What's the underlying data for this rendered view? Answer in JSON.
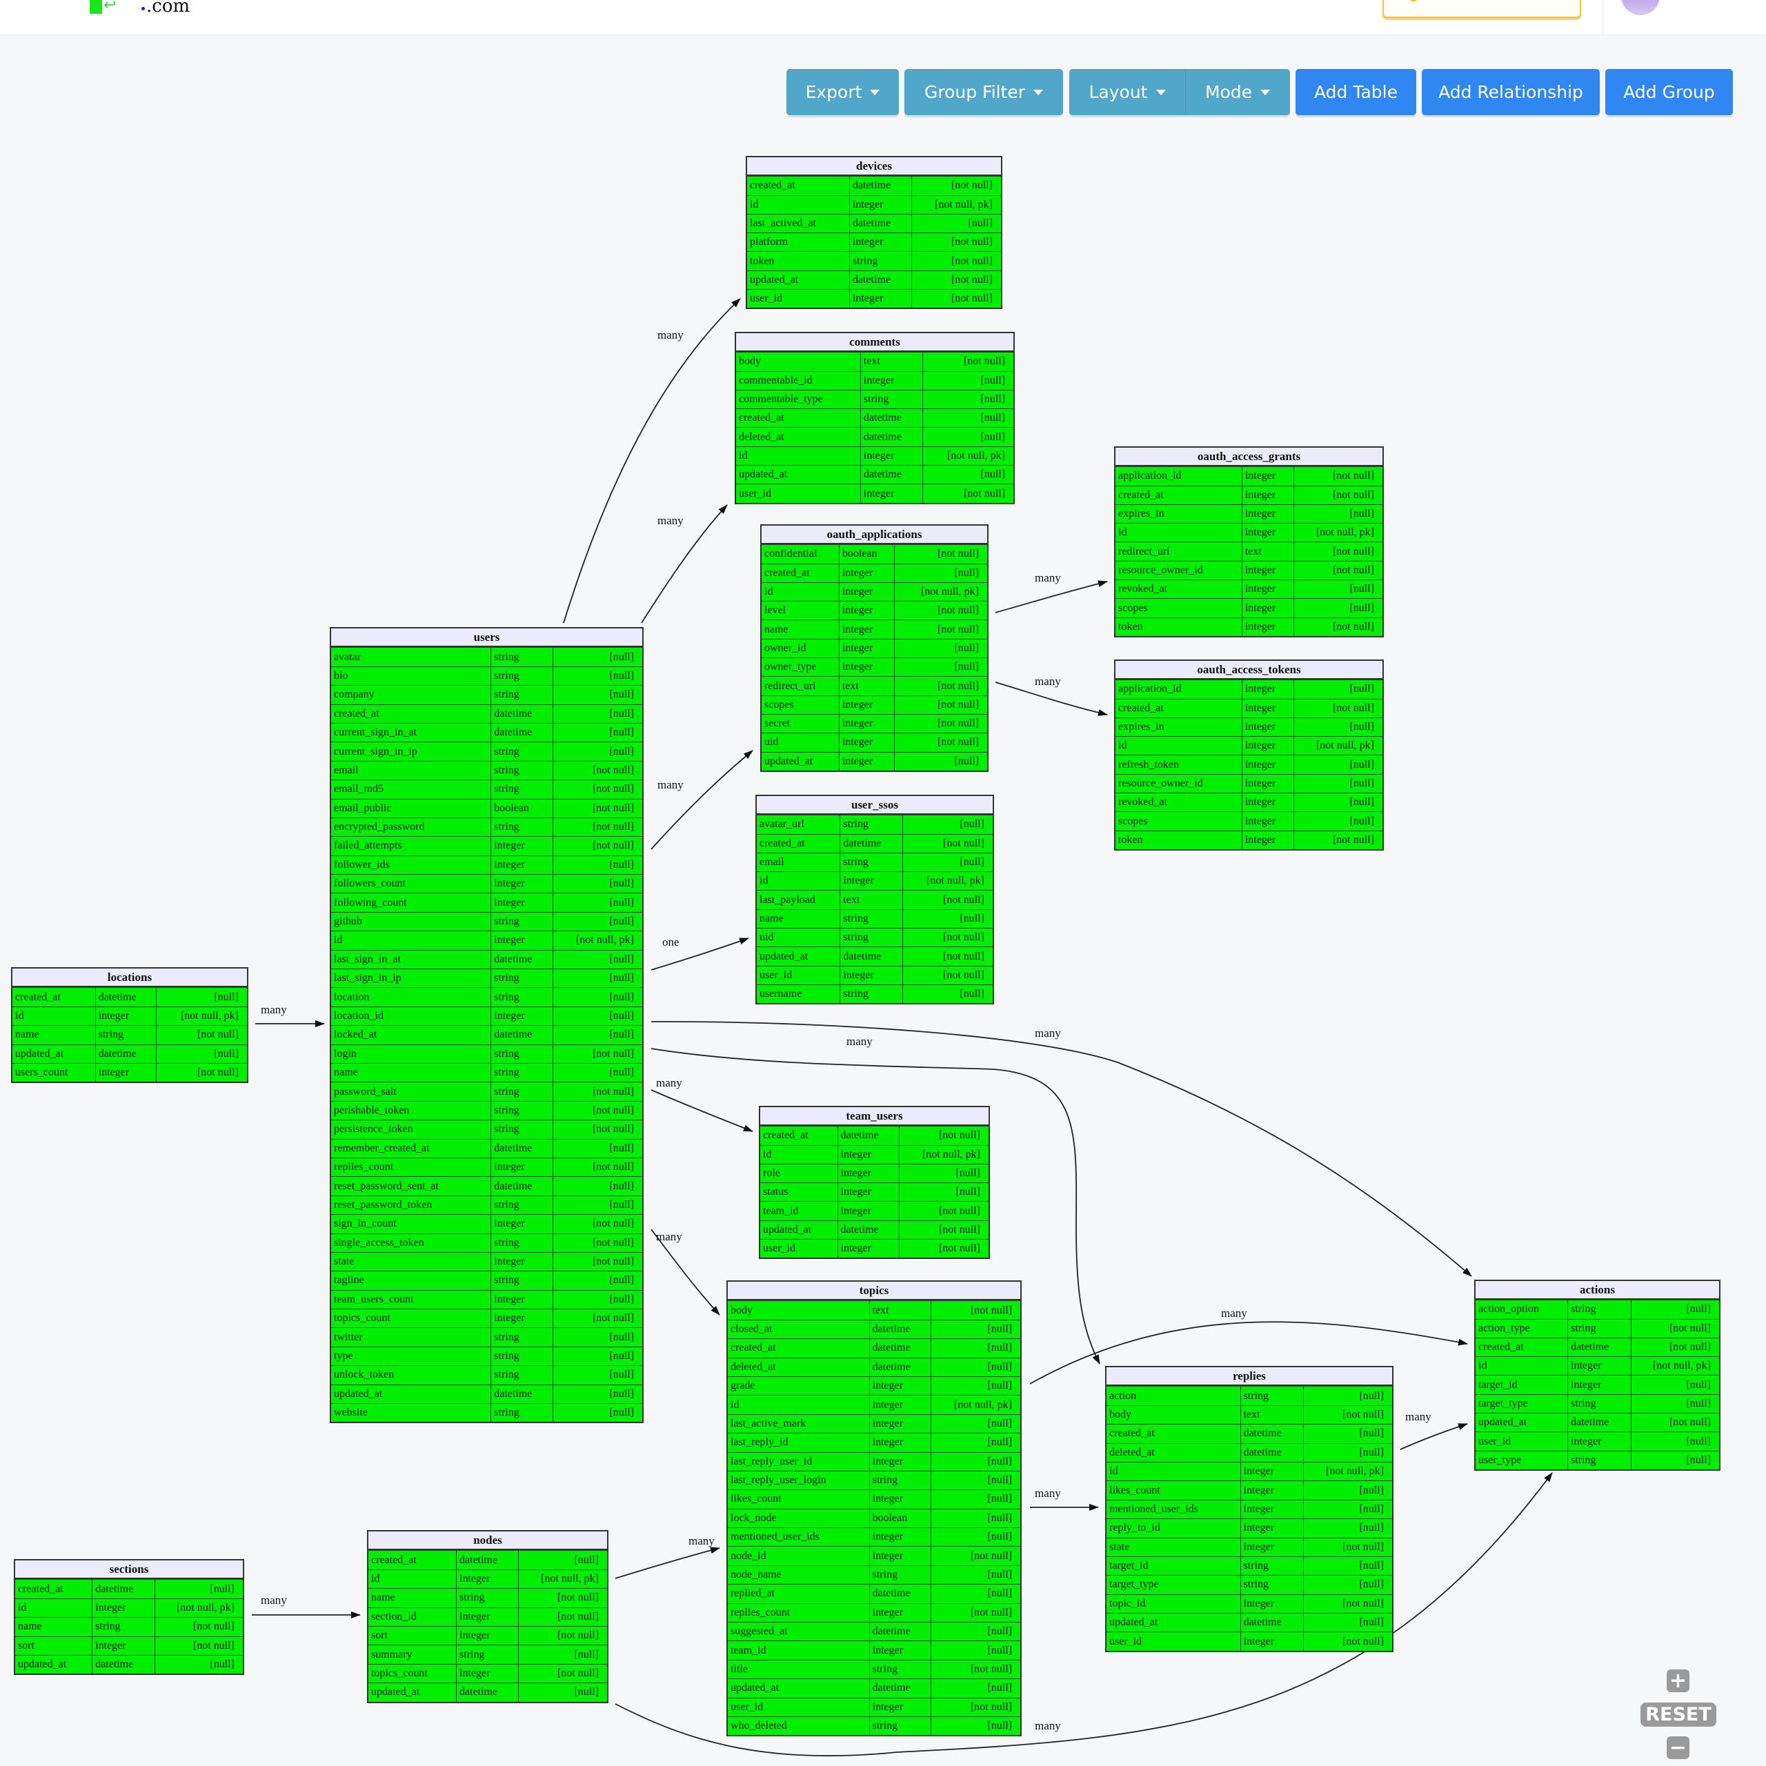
{
  "header": {
    "logo_suffix": ".com",
    "logo_icon": "return-arrow-icon"
  },
  "toolbar": {
    "export": "Export",
    "group_filter": "Group Filter",
    "layout": "Layout",
    "mode": "Mode",
    "add_table": "Add Table",
    "add_relationship": "Add Relationship",
    "add_group": "Add Group"
  },
  "colors": {
    "row_bg": "#00ee00",
    "header_bg": "#ebebfb",
    "info_button": "#51a7c9",
    "primary_button": "#2f87ef"
  },
  "zoom_controls": {
    "zoom_in": "+",
    "reset": "RESET",
    "zoom_out": "−"
  },
  "tables": {
    "devices": {
      "name": "devices",
      "columns": [
        [
          "created_at",
          "datetime",
          "[not null]"
        ],
        [
          "id",
          "integer",
          "[not null, pk]"
        ],
        [
          "last_actived_at",
          "datetime",
          "[null]"
        ],
        [
          "platform",
          "integer",
          "[not null]"
        ],
        [
          "token",
          "string",
          "[not null]"
        ],
        [
          "updated_at",
          "datetime",
          "[not null]"
        ],
        [
          "user_id",
          "integer",
          "[not null]"
        ]
      ]
    },
    "comments": {
      "name": "comments",
      "columns": [
        [
          "body",
          "text",
          "[not null]"
        ],
        [
          "commentable_id",
          "integer",
          "[null]"
        ],
        [
          "commentable_type",
          "string",
          "[null]"
        ],
        [
          "created_at",
          "datetime",
          "[null]"
        ],
        [
          "deleted_at",
          "datetime",
          "[null]"
        ],
        [
          "id",
          "integer",
          "[not null, pk]"
        ],
        [
          "updated_at",
          "datetime",
          "[null]"
        ],
        [
          "user_id",
          "integer",
          "[not null]"
        ]
      ]
    },
    "oauth_applications": {
      "name": "oauth_applications",
      "columns": [
        [
          "confidential",
          "boolean",
          "[not null]"
        ],
        [
          "created_at",
          "integer",
          "[null]"
        ],
        [
          "id",
          "integer",
          "[not null, pk]"
        ],
        [
          "level",
          "integer",
          "[not null]"
        ],
        [
          "name",
          "integer",
          "[not null]"
        ],
        [
          "owner_id",
          "integer",
          "[null]"
        ],
        [
          "owner_type",
          "integer",
          "[null]"
        ],
        [
          "redirect_uri",
          "text",
          "[not null]"
        ],
        [
          "scopes",
          "integer",
          "[not null]"
        ],
        [
          "secret",
          "integer",
          "[not null]"
        ],
        [
          "uid",
          "integer",
          "[not null]"
        ],
        [
          "updated_at",
          "integer",
          "[null]"
        ]
      ]
    },
    "oauth_access_grants": {
      "name": "oauth_access_grants",
      "columns": [
        [
          "application_id",
          "integer",
          "[not null]"
        ],
        [
          "created_at",
          "integer",
          "[not null]"
        ],
        [
          "expires_in",
          "integer",
          "[null]"
        ],
        [
          "id",
          "integer",
          "[not null, pk]"
        ],
        [
          "redirect_uri",
          "text",
          "[not null]"
        ],
        [
          "resource_owner_id",
          "integer",
          "[not null]"
        ],
        [
          "revoked_at",
          "integer",
          "[null]"
        ],
        [
          "scopes",
          "integer",
          "[null]"
        ],
        [
          "token",
          "integer",
          "[not null]"
        ]
      ]
    },
    "oauth_access_tokens": {
      "name": "oauth_access_tokens",
      "columns": [
        [
          "application_id",
          "integer",
          "[null]"
        ],
        [
          "created_at",
          "integer",
          "[not null]"
        ],
        [
          "expires_in",
          "integer",
          "[null]"
        ],
        [
          "id",
          "integer",
          "[not null, pk]"
        ],
        [
          "refresh_token",
          "integer",
          "[null]"
        ],
        [
          "resource_owner_id",
          "integer",
          "[null]"
        ],
        [
          "revoked_at",
          "integer",
          "[null]"
        ],
        [
          "scopes",
          "integer",
          "[null]"
        ],
        [
          "token",
          "integer",
          "[not null]"
        ]
      ]
    },
    "user_ssos": {
      "name": "user_ssos",
      "columns": [
        [
          "avatar_url",
          "string",
          "[null]"
        ],
        [
          "created_at",
          "datetime",
          "[not null]"
        ],
        [
          "email",
          "string",
          "[null]"
        ],
        [
          "id",
          "integer",
          "[not null, pk]"
        ],
        [
          "last_payload",
          "text",
          "[not null]"
        ],
        [
          "name",
          "string",
          "[null]"
        ],
        [
          "uid",
          "string",
          "[not null]"
        ],
        [
          "updated_at",
          "datetime",
          "[not null]"
        ],
        [
          "user_id",
          "integer",
          "[not null]"
        ],
        [
          "username",
          "string",
          "[null]"
        ]
      ]
    },
    "users": {
      "name": "users",
      "columns": [
        [
          "avatar",
          "string",
          "[null]"
        ],
        [
          "bio",
          "string",
          "[null]"
        ],
        [
          "company",
          "string",
          "[null]"
        ],
        [
          "created_at",
          "datetime",
          "[null]"
        ],
        [
          "current_sign_in_at",
          "datetime",
          "[null]"
        ],
        [
          "current_sign_in_ip",
          "string",
          "[null]"
        ],
        [
          "email",
          "string",
          "[not null]"
        ],
        [
          "email_md5",
          "string",
          "[not null]"
        ],
        [
          "email_public",
          "boolean",
          "[not null]"
        ],
        [
          "encrypted_password",
          "string",
          "[not null]"
        ],
        [
          "failed_attempts",
          "integer",
          "[not null]"
        ],
        [
          "follower_ids",
          "integer",
          "[null]"
        ],
        [
          "followers_count",
          "integer",
          "[null]"
        ],
        [
          "following_count",
          "integer",
          "[null]"
        ],
        [
          "github",
          "string",
          "[null]"
        ],
        [
          "id",
          "integer",
          "[not null, pk]"
        ],
        [
          "last_sign_in_at",
          "datetime",
          "[null]"
        ],
        [
          "last_sign_in_ip",
          "string",
          "[null]"
        ],
        [
          "location",
          "string",
          "[null]"
        ],
        [
          "location_id",
          "integer",
          "[null]"
        ],
        [
          "locked_at",
          "datetime",
          "[null]"
        ],
        [
          "login",
          "string",
          "[not null]"
        ],
        [
          "name",
          "string",
          "[null]"
        ],
        [
          "password_salt",
          "string",
          "[not null]"
        ],
        [
          "perishable_token",
          "string",
          "[not null]"
        ],
        [
          "persistence_token",
          "string",
          "[not null]"
        ],
        [
          "remember_created_at",
          "datetime",
          "[null]"
        ],
        [
          "replies_count",
          "integer",
          "[not null]"
        ],
        [
          "reset_password_sent_at",
          "datetime",
          "[null]"
        ],
        [
          "reset_password_token",
          "string",
          "[null]"
        ],
        [
          "sign_in_count",
          "integer",
          "[not null]"
        ],
        [
          "single_access_token",
          "string",
          "[not null]"
        ],
        [
          "state",
          "integer",
          "[not null]"
        ],
        [
          "tagline",
          "string",
          "[null]"
        ],
        [
          "team_users_count",
          "integer",
          "[null]"
        ],
        [
          "topics_count",
          "integer",
          "[not null]"
        ],
        [
          "twitter",
          "string",
          "[null]"
        ],
        [
          "type",
          "string",
          "[null]"
        ],
        [
          "unlock_token",
          "string",
          "[null]"
        ],
        [
          "updated_at",
          "datetime",
          "[null]"
        ],
        [
          "website",
          "string",
          "[null]"
        ]
      ]
    },
    "locations": {
      "name": "locations",
      "columns": [
        [
          "created_at",
          "datetime",
          "[null]"
        ],
        [
          "id",
          "integer",
          "[not null, pk]"
        ],
        [
          "name",
          "string",
          "[not null]"
        ],
        [
          "updated_at",
          "datetime",
          "[null]"
        ],
        [
          "users_count",
          "integer",
          "[not null]"
        ]
      ]
    },
    "team_users": {
      "name": "team_users",
      "columns": [
        [
          "created_at",
          "datetime",
          "[not null]"
        ],
        [
          "id",
          "integer",
          "[not null, pk]"
        ],
        [
          "role",
          "integer",
          "[null]"
        ],
        [
          "status",
          "integer",
          "[null]"
        ],
        [
          "team_id",
          "integer",
          "[not null]"
        ],
        [
          "updated_at",
          "datetime",
          "[not null]"
        ],
        [
          "user_id",
          "integer",
          "[not null]"
        ]
      ]
    },
    "topics": {
      "name": "topics",
      "columns": [
        [
          "body",
          "text",
          "[not null]"
        ],
        [
          "closed_at",
          "datetime",
          "[null]"
        ],
        [
          "created_at",
          "datetime",
          "[null]"
        ],
        [
          "deleted_at",
          "datetime",
          "[null]"
        ],
        [
          "grade",
          "integer",
          "[null]"
        ],
        [
          "id",
          "integer",
          "[not null, pk]"
        ],
        [
          "last_active_mark",
          "integer",
          "[null]"
        ],
        [
          "last_reply_id",
          "integer",
          "[null]"
        ],
        [
          "last_reply_user_id",
          "integer",
          "[null]"
        ],
        [
          "last_reply_user_login",
          "string",
          "[null]"
        ],
        [
          "likes_count",
          "integer",
          "[null]"
        ],
        [
          "lock_node",
          "boolean",
          "[null]"
        ],
        [
          "mentioned_user_ids",
          "integer",
          "[null]"
        ],
        [
          "node_id",
          "integer",
          "[not null]"
        ],
        [
          "node_name",
          "string",
          "[null]"
        ],
        [
          "replied_at",
          "datetime",
          "[null]"
        ],
        [
          "replies_count",
          "integer",
          "[not null]"
        ],
        [
          "suggested_at",
          "datetime",
          "[null]"
        ],
        [
          "team_id",
          "integer",
          "[null]"
        ],
        [
          "title",
          "string",
          "[not null]"
        ],
        [
          "updated_at",
          "datetime",
          "[null]"
        ],
        [
          "user_id",
          "integer",
          "[not null]"
        ],
        [
          "who_deleted",
          "string",
          "[null]"
        ]
      ]
    },
    "replies": {
      "name": "replies",
      "columns": [
        [
          "action",
          "string",
          "[null]"
        ],
        [
          "body",
          "text",
          "[not null]"
        ],
        [
          "created_at",
          "datetime",
          "[null]"
        ],
        [
          "deleted_at",
          "datetime",
          "[null]"
        ],
        [
          "id",
          "integer",
          "[not null, pk]"
        ],
        [
          "likes_count",
          "integer",
          "[null]"
        ],
        [
          "mentioned_user_ids",
          "integer",
          "[null]"
        ],
        [
          "reply_to_id",
          "integer",
          "[null]"
        ],
        [
          "state",
          "integer",
          "[not null]"
        ],
        [
          "target_id",
          "string",
          "[null]"
        ],
        [
          "target_type",
          "string",
          "[null]"
        ],
        [
          "topic_id",
          "integer",
          "[not null]"
        ],
        [
          "updated_at",
          "datetime",
          "[null]"
        ],
        [
          "user_id",
          "integer",
          "[not null]"
        ]
      ]
    },
    "actions": {
      "name": "actions",
      "columns": [
        [
          "action_option",
          "string",
          "[null]"
        ],
        [
          "action_type",
          "string",
          "[not null]"
        ],
        [
          "created_at",
          "datetime",
          "[not null]"
        ],
        [
          "id",
          "integer",
          "[not null, pk]"
        ],
        [
          "target_id",
          "integer",
          "[null]"
        ],
        [
          "target_type",
          "string",
          "[null]"
        ],
        [
          "updated_at",
          "datetime",
          "[not null]"
        ],
        [
          "user_id",
          "integer",
          "[null]"
        ],
        [
          "user_type",
          "string",
          "[null]"
        ]
      ]
    },
    "sections": {
      "name": "sections",
      "columns": [
        [
          "created_at",
          "datetime",
          "[null]"
        ],
        [
          "id",
          "integer",
          "[not null, pk]"
        ],
        [
          "name",
          "string",
          "[not null]"
        ],
        [
          "sort",
          "integer",
          "[not null]"
        ],
        [
          "updated_at",
          "datetime",
          "[null]"
        ]
      ]
    },
    "nodes": {
      "name": "nodes",
      "columns": [
        [
          "created_at",
          "datetime",
          "[null]"
        ],
        [
          "id",
          "integer",
          "[not null, pk]"
        ],
        [
          "name",
          "string",
          "[not null]"
        ],
        [
          "section_id",
          "integer",
          "[not null]"
        ],
        [
          "sort",
          "integer",
          "[not null]"
        ],
        [
          "summary",
          "string",
          "[null]"
        ],
        [
          "topics_count",
          "integer",
          "[not null]"
        ],
        [
          "updated_at",
          "datetime",
          "[null]"
        ]
      ]
    }
  },
  "relationships": [
    {
      "from": "users",
      "to": "devices",
      "cardinality": "many"
    },
    {
      "from": "users",
      "to": "comments",
      "cardinality": "many"
    },
    {
      "from": "users",
      "to": "oauth_applications",
      "cardinality": "many"
    },
    {
      "from": "users",
      "to": "user_ssos",
      "cardinality": "one"
    },
    {
      "from": "locations",
      "to": "users",
      "cardinality": "many"
    },
    {
      "from": "users",
      "to": "team_users",
      "cardinality": "many"
    },
    {
      "from": "users",
      "to": "topics",
      "cardinality": "many"
    },
    {
      "from": "users",
      "to": "replies",
      "cardinality": "many"
    },
    {
      "from": "users",
      "to": "actions",
      "cardinality": "many"
    },
    {
      "from": "oauth_applications",
      "to": "oauth_access_grants",
      "cardinality": "many"
    },
    {
      "from": "oauth_applications",
      "to": "oauth_access_tokens",
      "cardinality": "many"
    },
    {
      "from": "topics",
      "to": "replies",
      "cardinality": "many"
    },
    {
      "from": "topics",
      "to": "actions",
      "cardinality": "many"
    },
    {
      "from": "replies",
      "to": "actions",
      "cardinality": "many"
    },
    {
      "from": "sections",
      "to": "nodes",
      "cardinality": "many"
    },
    {
      "from": "nodes",
      "to": "topics",
      "cardinality": "many"
    },
    {
      "from": "nodes",
      "to": "actions",
      "cardinality": "many"
    }
  ]
}
